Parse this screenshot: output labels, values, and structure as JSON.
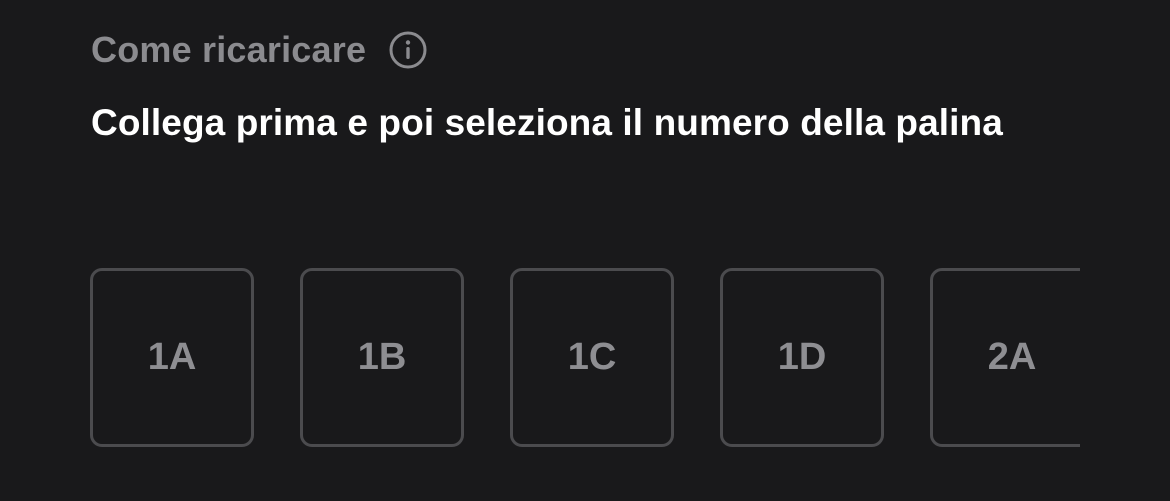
{
  "header": {
    "title": "Come ricaricare",
    "info_icon": "info-circle-icon"
  },
  "instruction": "Collega prima e poi seleziona il numero della palina",
  "slots": [
    {
      "label": "1A"
    },
    {
      "label": "1B"
    },
    {
      "label": "1C"
    },
    {
      "label": "1D"
    },
    {
      "label": "2A"
    }
  ],
  "colors": {
    "background": "#19191b",
    "title": "#8b8b8f",
    "instruction": "#ffffff",
    "slot_border": "#4b4b4e",
    "slot_text": "#8e8e92"
  }
}
